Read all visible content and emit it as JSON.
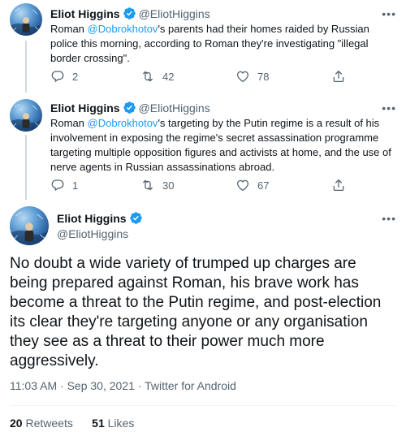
{
  "tweets": [
    {
      "name": "Eliot Higgins",
      "handle": "@EliotHiggins",
      "text_before": "Roman ",
      "mention": "@Dobrokhotov",
      "text_after": "'s parents had their homes raided by Russian police this morning, according to Roman they're investigating \"illegal border crossing\".",
      "replies": "2",
      "retweets": "42",
      "likes": "78"
    },
    {
      "name": "Eliot Higgins",
      "handle": "@EliotHiggins",
      "text_before": "Roman ",
      "mention": "@Dobrokhotov",
      "text_after": "'s targeting by the Putin regime is a result of his involvement in exposing the regime's secret assassination programme targeting multiple opposition figures and activists at home, and the use of nerve agents in Russian assassinations abroad.",
      "replies": "1",
      "retweets": "30",
      "likes": "67"
    }
  ],
  "main_tweet": {
    "name": "Eliot Higgins",
    "handle": "@EliotHiggins",
    "text": "No doubt a wide variety of trumped up charges are being prepared against Roman, his brave work has become a threat to the Putin regime, and post-election its clear they're targeting anyone or any organisation they see as a threat to their power much more aggressively.",
    "time": "11:03 AM",
    "date": "Sep 30, 2021",
    "source": "Twitter for Android",
    "retweets_count": "20",
    "retweets_label": "Retweets",
    "likes_count": "51",
    "likes_label": "Likes"
  },
  "colors": {
    "accent": "#1d9bf0",
    "muted": "#536471",
    "text": "#0f1419"
  },
  "icons": [
    "verified-badge-icon",
    "more-icon",
    "reply-icon",
    "retweet-icon",
    "like-icon",
    "share-icon"
  ]
}
